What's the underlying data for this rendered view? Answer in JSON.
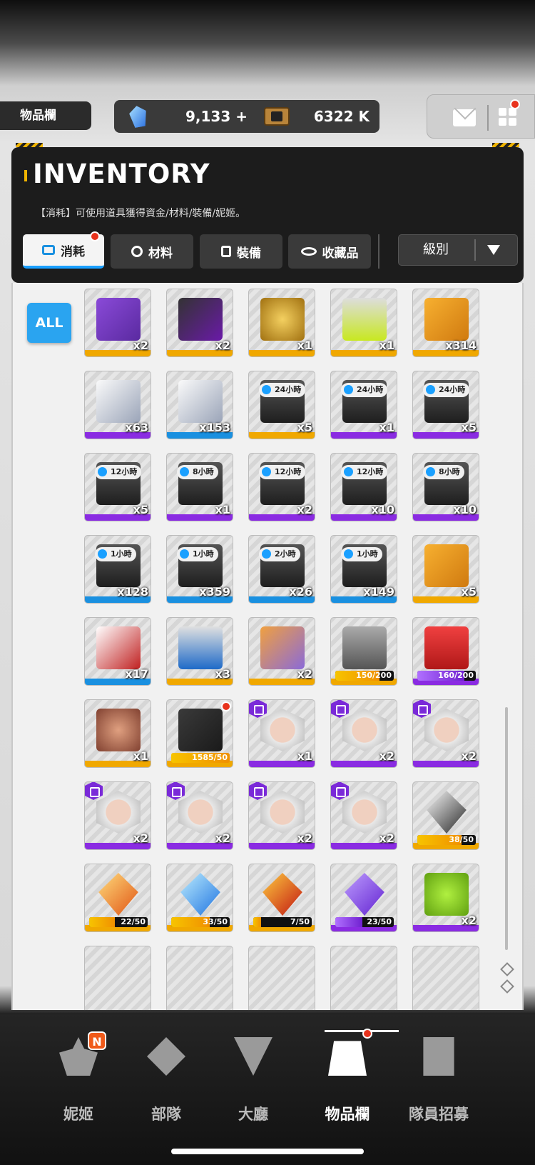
{
  "header": {
    "title": "物品欄",
    "gems": "9,133",
    "plus": "+",
    "credits": "6322 K"
  },
  "inventory": {
    "title": "INVENTORY",
    "description": "【消耗】可使用道具獲得資金/材料/裝備/妮姬。",
    "tabs": [
      {
        "label": "消耗",
        "icon": "consumable-icon"
      },
      {
        "label": "材料",
        "icon": "material-icon"
      },
      {
        "label": "裝備",
        "icon": "equipment-icon"
      },
      {
        "label": "收藏品",
        "icon": "collection-icon"
      }
    ],
    "sort_label": "級別",
    "all_button": "ALL"
  },
  "colors": {
    "gold": "#f0a800",
    "purple": "#8a2be2",
    "blue": "#1a90e0",
    "accent": "#2aa4f0",
    "alert": "#e8321c"
  },
  "items": [
    {
      "count": "x2",
      "rarity": "gold",
      "art": "gift-box"
    },
    {
      "count": "x2",
      "rarity": "gold",
      "art": "black-gift-box"
    },
    {
      "count": "x1",
      "rarity": "gold",
      "art": "trophy-2026"
    },
    {
      "count": "x1",
      "rarity": "gold",
      "art": "battery"
    },
    {
      "count": "x314",
      "rarity": "gold",
      "art": "orange-crate"
    },
    {
      "count": "x63",
      "rarity": "purple",
      "art": "silver-crate"
    },
    {
      "count": "x153",
      "rarity": "blue",
      "art": "silver-crate"
    },
    {
      "count": "x5",
      "rarity": "gold",
      "art": "case",
      "badge": "24小時"
    },
    {
      "count": "x1",
      "rarity": "purple",
      "art": "case",
      "badge": "24小時"
    },
    {
      "count": "x5",
      "rarity": "purple",
      "art": "case",
      "badge": "24小時"
    },
    {
      "count": "x5",
      "rarity": "purple",
      "art": "case",
      "badge": "12小時"
    },
    {
      "count": "x1",
      "rarity": "purple",
      "art": "case",
      "badge": "8小時"
    },
    {
      "count": "x2",
      "rarity": "purple",
      "art": "case",
      "badge": "12小時"
    },
    {
      "count": "x10",
      "rarity": "purple",
      "art": "case",
      "badge": "12小時"
    },
    {
      "count": "x10",
      "rarity": "purple",
      "art": "case",
      "badge": "8小時"
    },
    {
      "count": "x128",
      "rarity": "blue",
      "art": "case",
      "badge": "1小時"
    },
    {
      "count": "x359",
      "rarity": "blue",
      "art": "case",
      "badge": "1小時"
    },
    {
      "count": "x26",
      "rarity": "blue",
      "art": "case",
      "badge": "2小時"
    },
    {
      "count": "x149",
      "rarity": "blue",
      "art": "case",
      "badge": "1小時"
    },
    {
      "count": "x5",
      "rarity": "gold",
      "art": "orange-crate"
    },
    {
      "count": "x17",
      "rarity": "blue",
      "art": "red-crate"
    },
    {
      "count": "x3",
      "rarity": "gold",
      "art": "supply-basket"
    },
    {
      "count": "x2",
      "rarity": "gold",
      "art": "colorful-case"
    },
    {
      "progress": "150/200",
      "fill": 0.75,
      "rarity": "gold",
      "art": "metal-crate"
    },
    {
      "progress": "160/200",
      "fill": 0.8,
      "rarity": "purple",
      "art": "lucky-box"
    },
    {
      "count": "x1",
      "rarity": "gold",
      "art": "cake"
    },
    {
      "progress": "1585/50",
      "fill": 1,
      "rarity": "gold",
      "art": "dark-card",
      "alert": true
    },
    {
      "count": "x1",
      "rarity": "purple",
      "art": "portrait",
      "corner": true
    },
    {
      "count": "x2",
      "rarity": "purple",
      "art": "portrait",
      "corner": true
    },
    {
      "count": "x2",
      "rarity": "purple",
      "art": "portrait",
      "corner": true
    },
    {
      "count": "x2",
      "rarity": "purple",
      "art": "portrait",
      "corner": true
    },
    {
      "count": "x2",
      "rarity": "purple",
      "art": "portrait",
      "corner": true
    },
    {
      "count": "x2",
      "rarity": "purple",
      "art": "portrait",
      "corner": true
    },
    {
      "count": "x2",
      "rarity": "purple",
      "art": "portrait",
      "corner": true
    },
    {
      "progress": "38/50",
      "fill": 0.76,
      "rarity": "gold",
      "art": "white-crystal"
    },
    {
      "progress": "22/50",
      "fill": 0.44,
      "rarity": "gold",
      "art": "orange-crystal"
    },
    {
      "progress": "33/50",
      "fill": 0.66,
      "rarity": "gold",
      "art": "blue-crystal"
    },
    {
      "progress": "7/50",
      "fill": 0.14,
      "rarity": "gold",
      "art": "red-crystal"
    },
    {
      "progress": "23/50",
      "fill": 0.46,
      "rarity": "purple",
      "art": "purple-crystal"
    },
    {
      "count": "x2",
      "rarity": "purple",
      "art": "green-hex"
    }
  ],
  "nav": [
    {
      "label": "妮姬",
      "icon": "nikke-icon",
      "badge": "N"
    },
    {
      "label": "部隊",
      "icon": "squad-icon"
    },
    {
      "label": "大廳",
      "icon": "lobby-icon"
    },
    {
      "label": "物品欄",
      "icon": "inventory-icon",
      "active": true
    },
    {
      "label": "隊員招募",
      "icon": "recruit-icon"
    }
  ]
}
